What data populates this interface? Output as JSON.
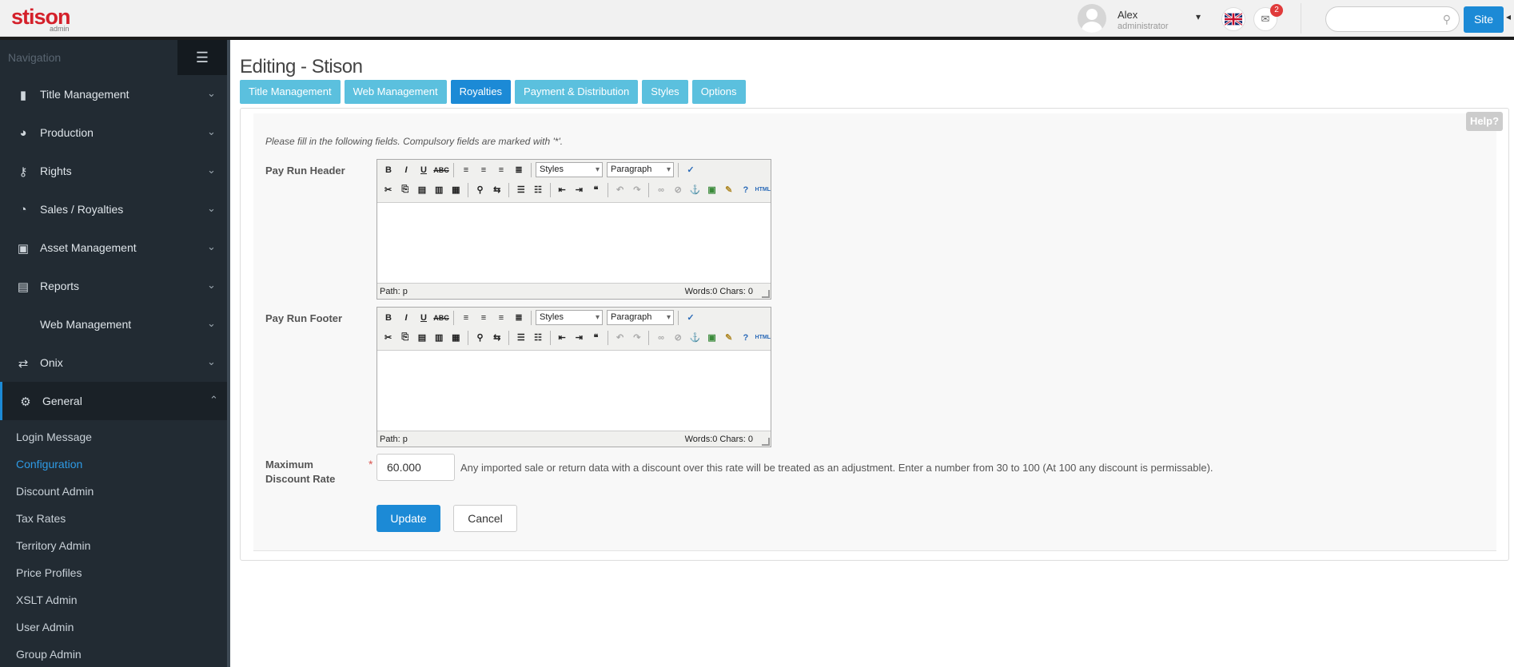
{
  "header": {
    "logo": "stison",
    "logo_sub": "admin",
    "user_name": "Alex",
    "user_role": "administrator",
    "notification_count": "2",
    "search_placeholder": "",
    "site_button": "Site"
  },
  "sidebar": {
    "title": "Navigation",
    "items": [
      {
        "label": "Title Management",
        "icon": "book-icon"
      },
      {
        "label": "Production",
        "icon": "dashboard-icon"
      },
      {
        "label": "Rights",
        "icon": "key-icon"
      },
      {
        "label": "Sales / Royalties",
        "icon": "pie-chart-icon"
      },
      {
        "label": "Asset Management",
        "icon": "image-icon"
      },
      {
        "label": "Reports",
        "icon": "file-icon"
      },
      {
        "label": "Web Management",
        "icon": ""
      },
      {
        "label": "Onix",
        "icon": "exchange-icon"
      },
      {
        "label": "General",
        "icon": "cogs-icon"
      }
    ],
    "subitems": [
      "Login Message",
      "Configuration",
      "Discount Admin",
      "Tax Rates",
      "Territory Admin",
      "Price Profiles",
      "XSLT Admin",
      "User Admin",
      "Group Admin"
    ]
  },
  "main": {
    "title": "Editing - Stison",
    "tabs": [
      "Title Management",
      "Web Management",
      "Royalties",
      "Payment & Distribution",
      "Styles",
      "Options"
    ],
    "help": "Help?",
    "intro": "Please fill in the following fields. Compulsory fields are marked with '*'.",
    "fields": {
      "pay_run_header": "Pay Run Header",
      "pay_run_footer": "Pay Run Footer",
      "max_discount_rate": "Maximum Discount Rate",
      "max_discount_value": "60.000",
      "max_discount_hint": "Any imported sale or return data with a discount over this rate will be treated as an adjustment. Enter a number from 30 to 100 (At 100 any discount is permissable).",
      "required_marker": "*"
    },
    "editor": {
      "styles_label": "Styles",
      "format_label": "Paragraph",
      "path": "Path: p",
      "counts": "Words:0 Chars: 0"
    },
    "buttons": {
      "update": "Update",
      "cancel": "Cancel"
    }
  },
  "colors": {
    "accent": "#1c8ad6",
    "tab": "#5bc0de",
    "sidebar": "#222b33",
    "brand": "#d4202a"
  }
}
